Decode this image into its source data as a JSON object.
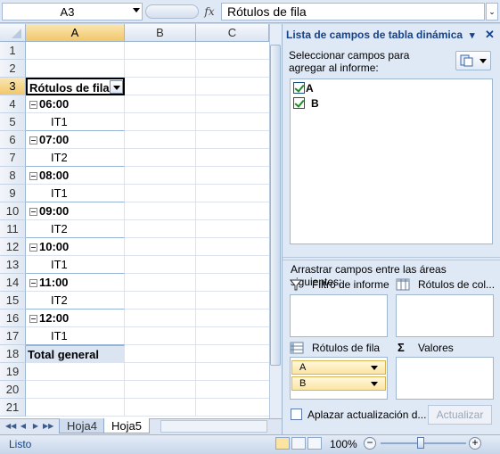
{
  "formula_bar": {
    "name_box": "A3",
    "fx_label": "fx",
    "content": "Rótulos de fila"
  },
  "grid": {
    "columns": [
      "A",
      "B",
      "C"
    ],
    "rows": [
      {
        "num": "1",
        "a": "",
        "type": "empty"
      },
      {
        "num": "2",
        "a": "",
        "type": "empty"
      },
      {
        "num": "3",
        "a": "Rótulos de fila",
        "type": "header"
      },
      {
        "num": "4",
        "a": "06:00",
        "type": "group"
      },
      {
        "num": "5",
        "a": "IT1",
        "type": "item"
      },
      {
        "num": "6",
        "a": "07:00",
        "type": "group"
      },
      {
        "num": "7",
        "a": "IT2",
        "type": "item"
      },
      {
        "num": "8",
        "a": "08:00",
        "type": "group"
      },
      {
        "num": "9",
        "a": "IT1",
        "type": "item"
      },
      {
        "num": "10",
        "a": "09:00",
        "type": "group"
      },
      {
        "num": "11",
        "a": "IT2",
        "type": "item"
      },
      {
        "num": "12",
        "a": "10:00",
        "type": "group"
      },
      {
        "num": "13",
        "a": "IT1",
        "type": "item"
      },
      {
        "num": "14",
        "a": "11:00",
        "type": "group"
      },
      {
        "num": "15",
        "a": "IT2",
        "type": "item"
      },
      {
        "num": "16",
        "a": "12:00",
        "type": "group"
      },
      {
        "num": "17",
        "a": "IT1",
        "type": "item"
      },
      {
        "num": "18",
        "a": "Total general",
        "type": "total"
      },
      {
        "num": "19",
        "a": "",
        "type": "empty"
      },
      {
        "num": "20",
        "a": "",
        "type": "empty"
      },
      {
        "num": "21",
        "a": "",
        "type": "empty"
      }
    ]
  },
  "sheet_tabs": [
    {
      "label": "Hoja4",
      "active": false
    },
    {
      "label": "Hoja5",
      "active": true
    }
  ],
  "pivot_panel": {
    "title": "Lista de campos de tabla dinámica",
    "choose_label": "Seleccionar campos para agregar al informe:",
    "fields": [
      {
        "label": "A",
        "checked": true
      },
      {
        "label": "B",
        "checked": true
      }
    ],
    "drag_label": "Arrastrar campos entre las áreas siguientes:",
    "areas": {
      "filter": "Filtro de informe",
      "columns": "Rótulos de col...",
      "rows": "Rótulos de fila",
      "values": "Valores"
    },
    "row_fields": [
      "A",
      "B"
    ],
    "defer_label": "Aplazar actualización d...",
    "update_button": "Actualizar"
  },
  "status_bar": {
    "status": "Listo",
    "zoom": "100%"
  }
}
